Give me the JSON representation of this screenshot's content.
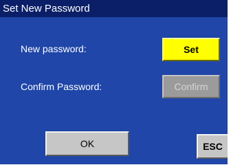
{
  "dialog": {
    "title": "Set New Password"
  },
  "fields": {
    "new_password_label": "New password:",
    "confirm_password_label": "Confirm Password:"
  },
  "buttons": {
    "set_label": "Set",
    "confirm_label": "Confirm",
    "ok_label": "OK",
    "esc_label": "ESC"
  },
  "colors": {
    "panel_background": "#1f46a8",
    "title_bar_background": "#0a1f67",
    "set_button": "#ffff00",
    "confirm_button_disabled": "#9b9b9b",
    "ok_esc_button": "#c6c6c6"
  }
}
